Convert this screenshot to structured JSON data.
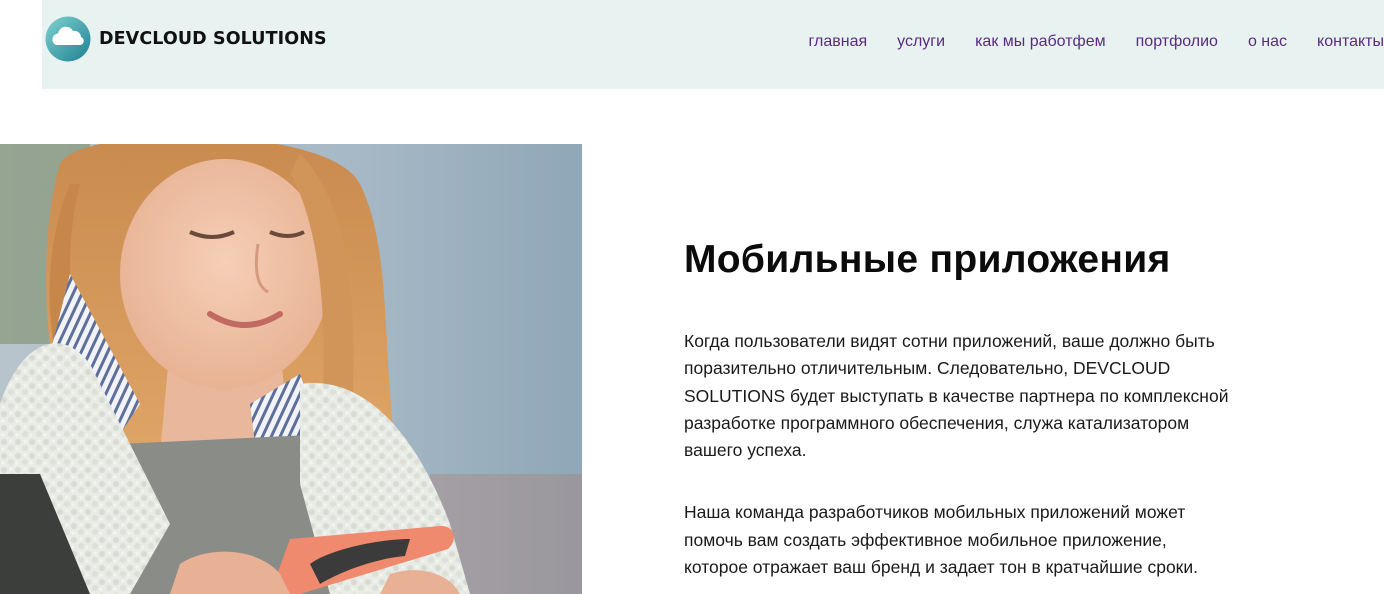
{
  "header": {
    "brand": "DEVCLOUD SOLUTIONS",
    "nav": [
      {
        "label": "главная"
      },
      {
        "label": "услуги"
      },
      {
        "label": "как мы работфем"
      },
      {
        "label": "портфолио"
      },
      {
        "label": "о нас"
      },
      {
        "label": "контакты"
      }
    ]
  },
  "main": {
    "title": "Мобильные приложения",
    "paragraphs": [
      "Когда пользователи видят сотни приложений, ваше должно быть поразительно отличительным. Следовательно, DEVCLOUD SOLUTIONS будет выступать в качестве партнера по комплексной разработке программного обеспечения, служа катализатором вашего успеха.",
      "Наша команда разработчиков мобильных приложений может помочь вам создать эффективное мобильное приложение, которое отражает ваш бренд и задает тон в кратчайшие сроки."
    ]
  },
  "icons": {
    "logo": "cloud-logo-icon",
    "photo": "woman-with-phone-photo"
  },
  "colors": {
    "header_bg": "#e8f3f1",
    "nav_link": "#5b2a82",
    "logo_teal": "#2a9fa6"
  }
}
